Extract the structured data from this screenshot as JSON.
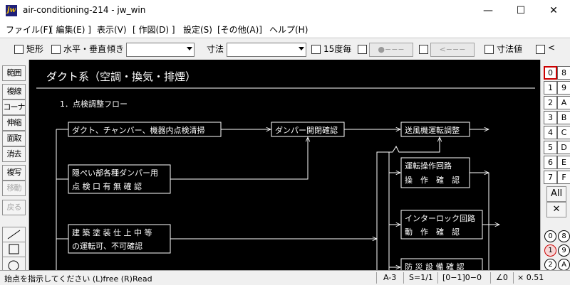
{
  "window": {
    "title": "air-conditioning-214 - jw_win",
    "icon_text": "jw",
    "minimize": "—",
    "maximize": "☐",
    "close": "✕"
  },
  "menu": [
    "ファイル(F)",
    "[ 編集(E) ]",
    "表示(V)",
    "[ 作図(D) ]",
    "設定(S)",
    "[その他(A)]",
    "ヘルプ(H)"
  ],
  "toolbar": {
    "rect_label": "矩形",
    "hv_label": "水平・垂直",
    "tilt_label": "傾き",
    "tilt_value": "",
    "dim_label": "寸法",
    "dim_value": "",
    "deg15_label": "15度毎",
    "seg1": "●−−−",
    "seg2": "<−−−",
    "dimval_label": "寸法値",
    "lt_label": "<"
  },
  "left_tools": [
    "範囲",
    "複線",
    "コーナー",
    "伸縮",
    "面取",
    "消去",
    "複写",
    "移動",
    "戻る"
  ],
  "right_tools": {
    "layer_groups": [
      [
        "0",
        "8"
      ],
      [
        "1",
        "9"
      ],
      [
        "2",
        "A"
      ],
      [
        "3",
        "B"
      ],
      [
        "4",
        "C"
      ],
      [
        "5",
        "D"
      ],
      [
        "6",
        "E"
      ],
      [
        "7",
        "F"
      ]
    ],
    "all_label": "All",
    "x_label": "✕",
    "layers": [
      [
        "0",
        "8"
      ],
      [
        "1",
        "9"
      ],
      [
        "2",
        "A"
      ]
    ]
  },
  "drawing": {
    "heading": "ダクト系（空調・換気・排煙）",
    "subheading": "1．点検調整フロー",
    "boxes": {
      "b1": "ダクト、チャンバー、機器内点検清掃",
      "b2": "ダンパー開閉確認",
      "b3": "送風機運転調整",
      "b4a": "隠ぺい部各種ダンパー用",
      "b4b": "点 検 口 有 無 確 認",
      "b5a": "建 築 塗 装 仕 上 中 等",
      "b5b": "の運転可、不可確認",
      "b6a": "運転操作回路",
      "b6b": "操　作　確　認",
      "b7a": "インターロック回路",
      "b7b": "動　作　確　認",
      "b8a": "防 災 設 備 確 認"
    }
  },
  "status": {
    "message": "始点を指示してください (L)free (R)Read",
    "paper": "A-3",
    "scale": "S=1/1",
    "layer": "[0−1]0−0",
    "angle": "∠0",
    "ratio": "× 0.51"
  }
}
